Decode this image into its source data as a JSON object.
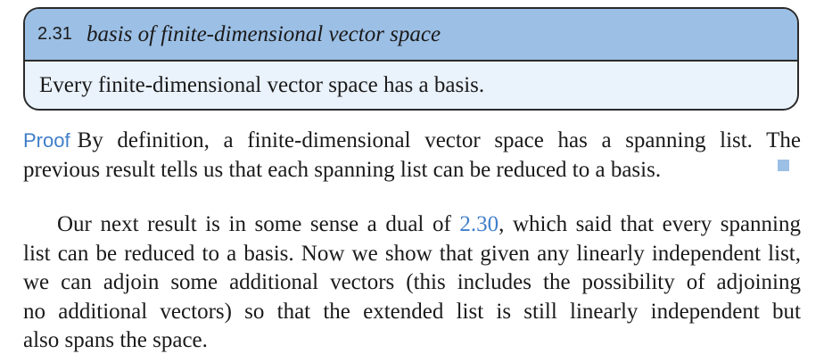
{
  "result": {
    "number": "2.31",
    "title": "basis of finite-dimensional vector space",
    "statement": "Every finite-dimensional vector space has a basis."
  },
  "proof": {
    "label": "Proof",
    "line1": "By definition, a finite-dimensional vector space has a spanning list. The",
    "line2": "previous result tells us that each spanning list can be reduced to a basis."
  },
  "next_paragraph": {
    "line1_pre": "Our next result is in some sense a dual of ",
    "line1_ref": "2.30",
    "line1_post": ", which said that every spanning",
    "line2": "list can be reduced to a basis. Now we show that given any linearly independent list,",
    "line3": "we can adjoin some additional vectors (this includes the possibility of adjoining",
    "line4": "no additional vectors) so that the extended list is still linearly independent but",
    "line5": "also spans the space."
  },
  "colors": {
    "header_blue": "#9cbfe5",
    "body_blue": "#eaf2fb",
    "link_blue": "#3f7fc9"
  }
}
